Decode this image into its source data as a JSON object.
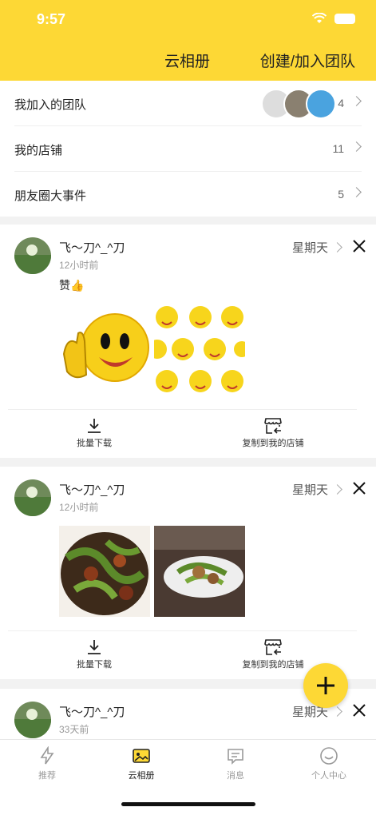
{
  "status": {
    "time": "9:57"
  },
  "header": {
    "title": "云相册",
    "create_label": "创建/加入团队"
  },
  "menu": [
    {
      "label": "我加入的团队",
      "count": "4"
    },
    {
      "label": "我的店铺",
      "count": "11"
    },
    {
      "label": "朋友圈大事件",
      "count": "5"
    }
  ],
  "posts": [
    {
      "name": "飞～刀^_^刀",
      "time": "12小时前",
      "day": "星期天",
      "text": "赞👍"
    },
    {
      "name": "飞～刀^_^刀",
      "time": "12小时前",
      "day": "星期天",
      "text": ""
    },
    {
      "name": "飞～刀^_^刀",
      "time": "33天前",
      "day": "星期天",
      "text": ""
    }
  ],
  "actions": {
    "download": "批量下载",
    "copy": "复制到我的店铺"
  },
  "tabs": [
    {
      "label": "推荐",
      "icon": "lightning-icon"
    },
    {
      "label": "云相册",
      "icon": "album-icon"
    },
    {
      "label": "消息",
      "icon": "message-icon"
    },
    {
      "label": "个人中心",
      "icon": "smile-icon"
    }
  ],
  "colors": {
    "accent": "#fdd835",
    "text": "#222222",
    "muted": "#999999"
  }
}
